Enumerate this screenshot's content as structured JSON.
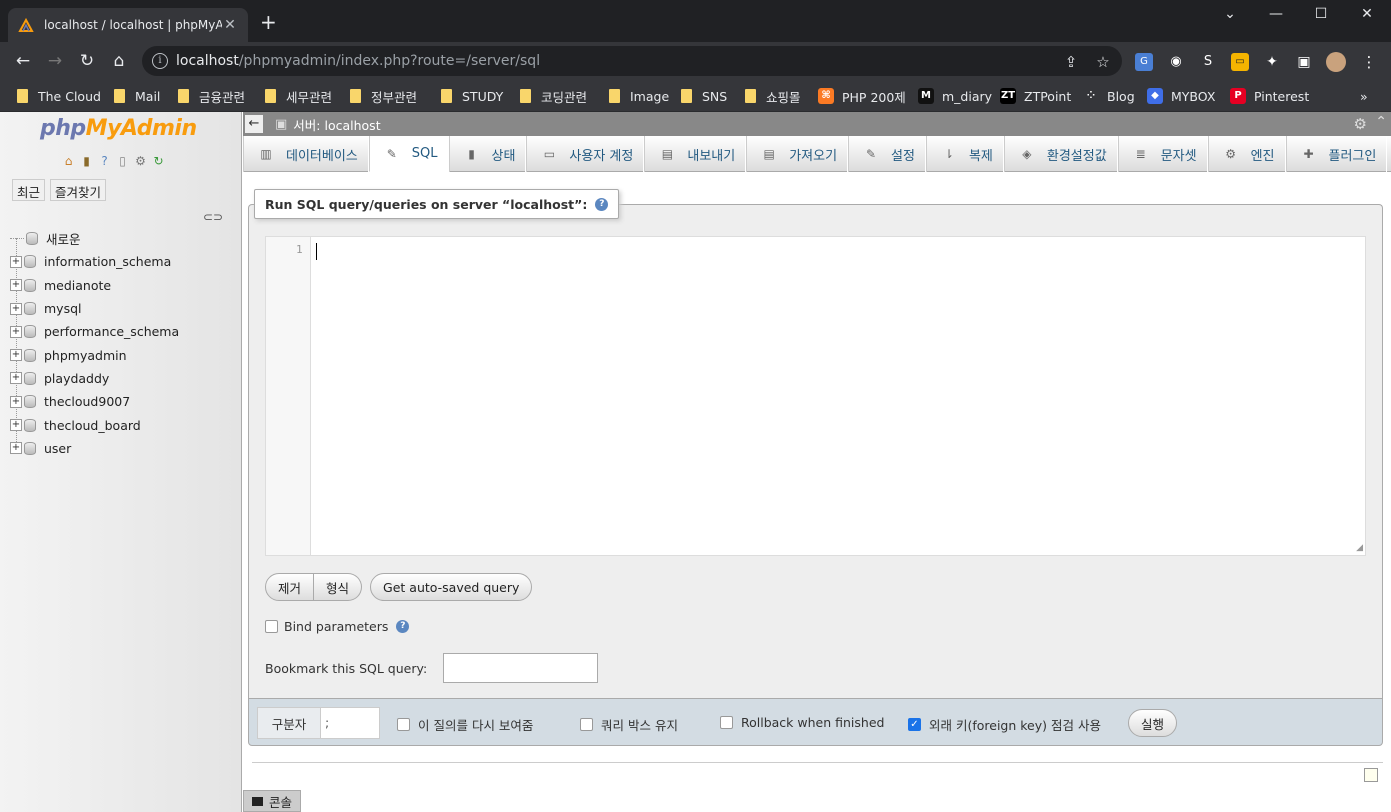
{
  "browser": {
    "tab_title": "localhost / localhost | phpMyAd",
    "tab_close": "✕",
    "new_tab": "+",
    "window_controls": {
      "minimize": "—",
      "maximize": "☐",
      "close": "✕"
    },
    "url_host": "localhost",
    "url_path": "/phpmyadmin/index.php?route=/server/sql",
    "bookmarks": [
      {
        "label": "The Cloud",
        "type": "folder"
      },
      {
        "label": "Mail",
        "type": "folder"
      },
      {
        "label": "금융관련",
        "type": "folder"
      },
      {
        "label": "세무관련",
        "type": "folder"
      },
      {
        "label": "정부관련",
        "type": "folder"
      },
      {
        "label": "STUDY",
        "type": "folder"
      },
      {
        "label": "코딩관련",
        "type": "folder"
      },
      {
        "label": "Image",
        "type": "folder"
      },
      {
        "label": "SNS",
        "type": "folder"
      },
      {
        "label": "쇼핑몰",
        "type": "folder"
      },
      {
        "label": "PHP 200제",
        "type": "site",
        "icon": "xampp-icon",
        "color": "#fb7a24",
        "glyph": "⌘"
      },
      {
        "label": "m_diary",
        "type": "site",
        "icon": "m-icon",
        "color": "#111111",
        "glyph": "M"
      },
      {
        "label": "ZTPoint",
        "type": "site",
        "icon": "zt-icon",
        "color": "#000000",
        "glyph": "ZT"
      },
      {
        "label": "Blog",
        "type": "site",
        "icon": "blog-icon",
        "color": "#35363a",
        "glyph": "⁘"
      },
      {
        "label": "MYBOX",
        "type": "site",
        "icon": "mybox-icon",
        "color": "#3f6ee8",
        "glyph": "◆"
      },
      {
        "label": "Pinterest",
        "type": "site",
        "icon": "pinterest-icon",
        "color": "#e60023",
        "glyph": "P"
      }
    ],
    "bookmarks_overflow": "»"
  },
  "nav": {
    "logo_php": "php",
    "logo_myadmin": "MyAdmin",
    "tabs": [
      "최근",
      "즐겨찾기"
    ],
    "tree": [
      {
        "label": "새로운",
        "kind": "new"
      },
      {
        "label": "information_schema"
      },
      {
        "label": "medianote"
      },
      {
        "label": "mysql"
      },
      {
        "label": "performance_schema"
      },
      {
        "label": "phpmyadmin"
      },
      {
        "label": "playdaddy"
      },
      {
        "label": "thecloud9007"
      },
      {
        "label": "thecloud_board"
      },
      {
        "label": "user"
      }
    ]
  },
  "breadcrumb": {
    "server": "서버: localhost"
  },
  "menu": [
    {
      "label": "데이터베이스",
      "icon": "database-icon",
      "glyph": "▥"
    },
    {
      "label": "SQL",
      "icon": "sql-icon",
      "glyph": "✎",
      "active": true
    },
    {
      "label": "상태",
      "icon": "status-icon",
      "glyph": "▮"
    },
    {
      "label": "사용자 계정",
      "icon": "users-icon",
      "glyph": "▭"
    },
    {
      "label": "내보내기",
      "icon": "export-icon",
      "glyph": "▤"
    },
    {
      "label": "가져오기",
      "icon": "import-icon",
      "glyph": "▤"
    },
    {
      "label": "설정",
      "icon": "settings-icon",
      "glyph": "✎"
    },
    {
      "label": "복제",
      "icon": "replication-icon",
      "glyph": "⇂"
    },
    {
      "label": "환경설정값",
      "icon": "variables-icon",
      "glyph": "◈"
    },
    {
      "label": "문자셋",
      "icon": "charset-icon",
      "glyph": "≣"
    },
    {
      "label": "엔진",
      "icon": "engine-icon",
      "glyph": "⚙"
    },
    {
      "label": "플러그인",
      "icon": "plugin-icon",
      "glyph": "✚"
    }
  ],
  "sql": {
    "legend": "Run SQL query/queries on server “localhost”:",
    "line_number": "1",
    "clear_btn": "제거",
    "format_btn": "형식",
    "autosave_btn": "Get auto-saved query",
    "bind_params": "Bind parameters",
    "bookmark_label": "Bookmark this SQL query:",
    "delimiter_label": "구분자",
    "delimiter_value": ";",
    "opt_show_again": "이 질의를 다시 보여줌",
    "opt_retain_box": "쿼리 박스 유지",
    "opt_rollback": "Rollback when finished",
    "opt_foreign_key": "외래 키(foreign key) 점검 사용",
    "opt_foreign_key_checked": true,
    "go_btn": "실행"
  },
  "console": {
    "label": "콘솔"
  },
  "colors": {
    "pma_blue": "#235a81",
    "logo_orange": "#f89c0e",
    "logo_purple": "#6c78af",
    "footer_bg": "#d3dce3"
  }
}
